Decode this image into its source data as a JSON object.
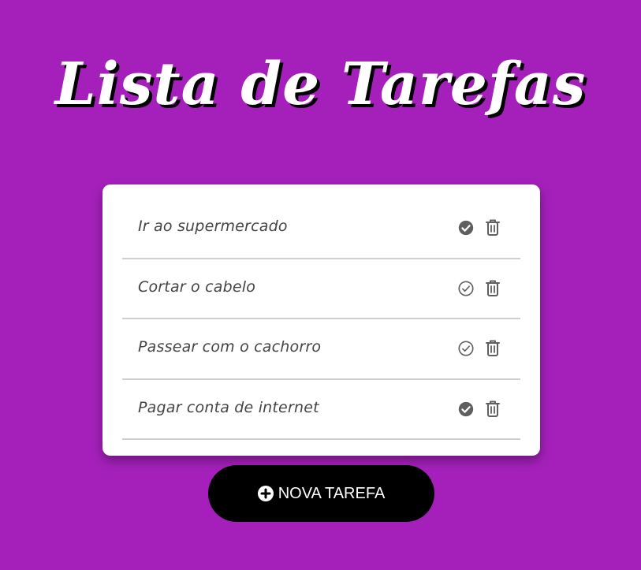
{
  "app": {
    "title": "Lista de Tarefas"
  },
  "tasks": [
    {
      "text": "Ir ao supermercado",
      "done": true
    },
    {
      "text": "Cortar o cabelo",
      "done": false
    },
    {
      "text": "Passear com o cachorro",
      "done": false
    },
    {
      "text": "Pagar conta de internet",
      "done": true
    }
  ],
  "actions": {
    "new_task_label": "NOVA TAREFA"
  },
  "icons": {
    "done": "check-circle-filled",
    "not_done": "check-circle-outline",
    "delete": "trash-icon",
    "add": "plus-circle-icon"
  },
  "colors": {
    "background": "#a520bb",
    "card": "#ffffff",
    "button": "#000000",
    "icon": "#5f5f5f",
    "divider": "#cfcfcf"
  }
}
